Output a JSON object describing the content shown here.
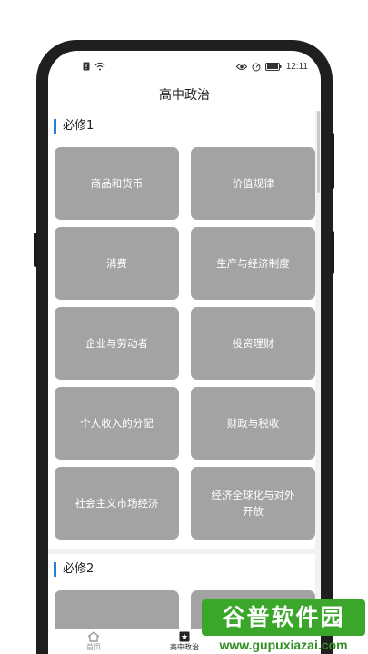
{
  "status": {
    "time": "12:11"
  },
  "header": {
    "title": "高中政治"
  },
  "sections": [
    {
      "label": "必修1",
      "cards": [
        "商品和货币",
        "价值规律",
        "消费",
        "生产与经济制度",
        "企业与劳动者",
        "投资理财",
        "个人收入的分配",
        "财政与税收",
        "社会主义市场经济",
        "经济全球化与对外开放"
      ]
    },
    {
      "label": "必修2"
    }
  ],
  "tabs": [
    {
      "label": "首页",
      "icon": "home-icon"
    },
    {
      "label": "高中政治",
      "icon": "star-book-icon"
    },
    {
      "label": "",
      "icon": ""
    }
  ],
  "watermark": {
    "brand": "谷普软件园",
    "url": "www.gupuxiazai.com"
  },
  "colors": {
    "accent": "#2a7fd4",
    "card": "#a3a3a3",
    "watermark": "#3aa62a"
  }
}
